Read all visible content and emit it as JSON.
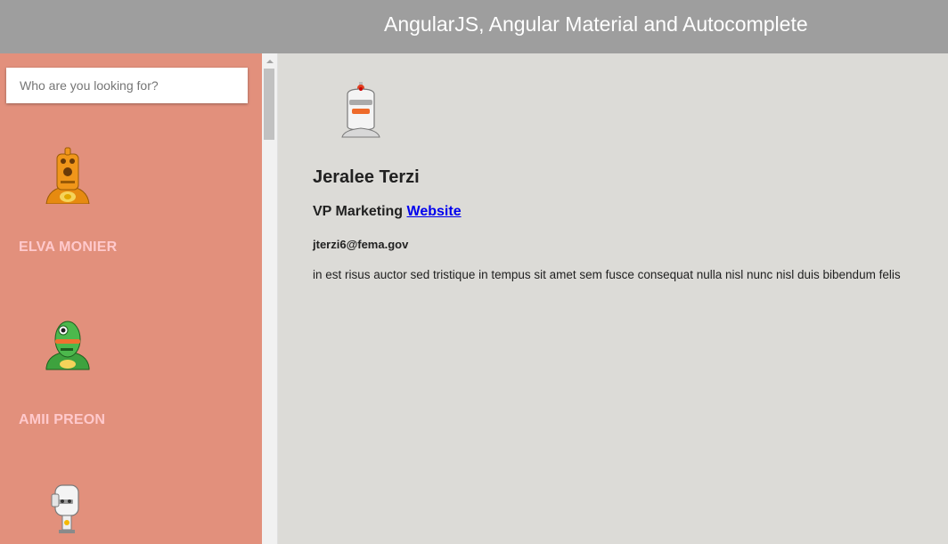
{
  "header": {
    "title": "AngularJS, Angular Material and Autocomplete"
  },
  "search": {
    "placeholder": "Who are you looking for?"
  },
  "people": [
    {
      "name": "ELVA MONIER",
      "avatar_icon": "orange-robot-icon"
    },
    {
      "name": "AMII PREON",
      "avatar_icon": "green-robot-icon"
    },
    {
      "name": "",
      "avatar_icon": "white-robot-icon"
    }
  ],
  "selected": {
    "name": "Jeralee Terzi",
    "title": "VP Marketing",
    "website_label": "Website",
    "email": "jterzi6@fema.gov",
    "bio": "in est risus auctor sed tristique in tempus sit amet sem fusce consequat nulla nisl nunc nisl duis bibendum felis"
  },
  "colors": {
    "header_bg": "#9e9e9e",
    "sidebar_bg": "#e2907c",
    "person_name": "#ffc9cc",
    "content_bg": "#dcdbd7",
    "link": "#0000ee"
  }
}
